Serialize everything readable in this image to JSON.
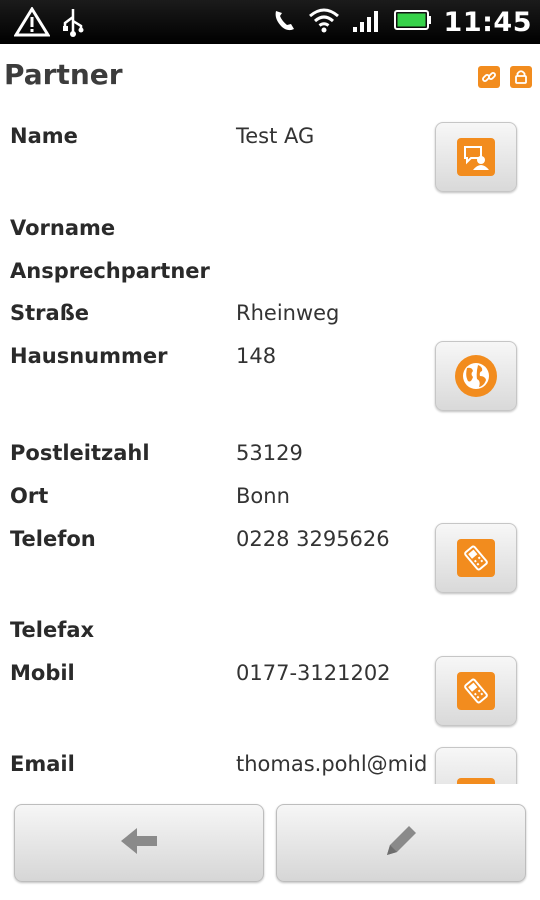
{
  "status_bar": {
    "time": "11:45",
    "icons": [
      "warning-icon",
      "usb-icon",
      "missed-call-icon",
      "wifi-icon",
      "signal-icon",
      "battery-icon"
    ]
  },
  "header": {
    "title": "Partner",
    "icons": [
      "link-icon",
      "lock-icon"
    ]
  },
  "fields": [
    {
      "label": "Name",
      "value": "Test AG",
      "action": "contact-card-icon"
    },
    {
      "label": "Vorname",
      "value": ""
    },
    {
      "label": "Ansprechpartner",
      "value": ""
    },
    {
      "label": "Straße",
      "value": "Rheinweg"
    },
    {
      "label": "Hausnummer",
      "value": "148",
      "action": "globe-icon"
    },
    {
      "label": "Postleitzahl",
      "value": "53129"
    },
    {
      "label": "Ort",
      "value": "Bonn"
    },
    {
      "label": "Telefon",
      "value": "0228 3295626",
      "action": "phone-icon"
    },
    {
      "label": "Telefax",
      "value": ""
    },
    {
      "label": "Mobil",
      "value": "0177-3121202",
      "action": "phone-icon"
    },
    {
      "label": "Email",
      "value": "thomas.pohl@mid",
      "action": "email-icon"
    }
  ],
  "bottom_bar": {
    "buttons": [
      "back-arrow-icon",
      "pencil-icon"
    ]
  },
  "colors": {
    "accent": "#f28c1e",
    "statusbar": "#000000",
    "title": "#3c3c3c"
  }
}
